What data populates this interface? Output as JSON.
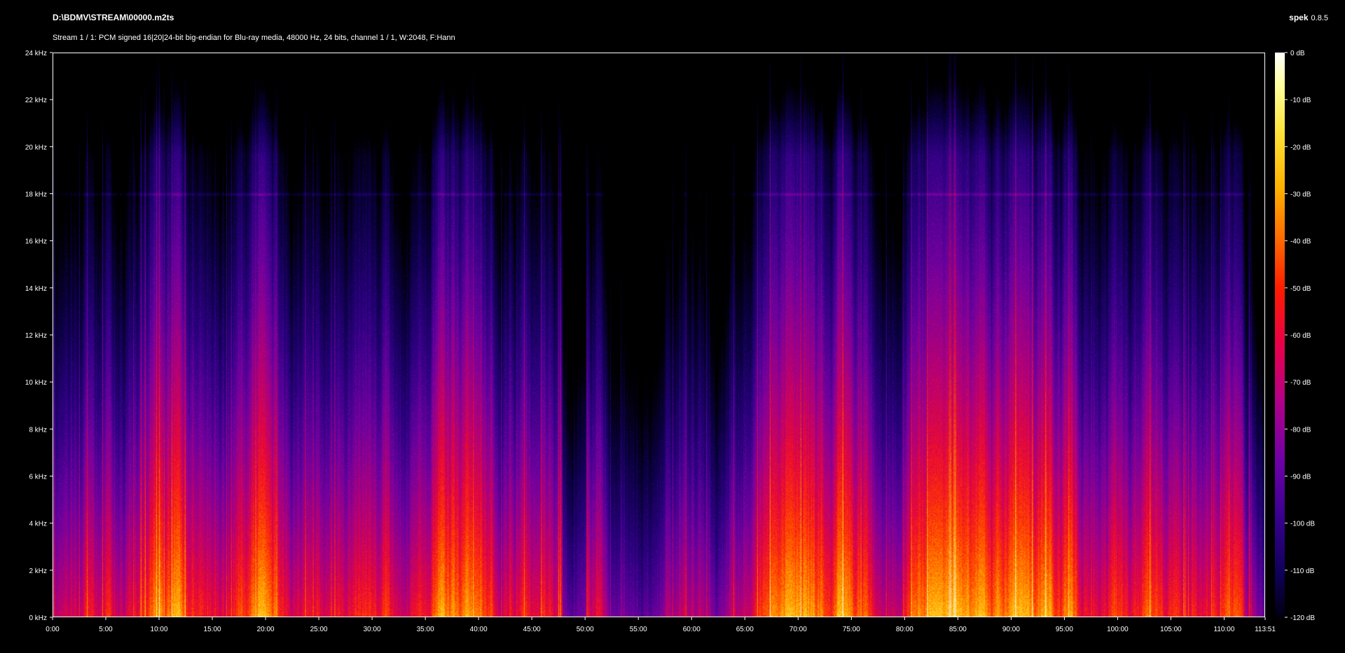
{
  "header": {
    "file_path": "D:\\BDMV\\STREAM\\00000.m2ts",
    "stream_info": "Stream 1 / 1: PCM signed 16|20|24-bit big-endian for Blu-ray media, 48000 Hz, 24 bits, channel 1 / 1, W:2048, F:Hann"
  },
  "app": {
    "name": "spek",
    "version": "0.8.5"
  },
  "freq_axis": {
    "ticks": [
      "24 kHz",
      "22 kHz",
      "20 kHz",
      "18 kHz",
      "16 kHz",
      "14 kHz",
      "12 kHz",
      "10 kHz",
      "8 kHz",
      "6 kHz",
      "4 kHz",
      "2 kHz",
      "0 kHz"
    ],
    "max_khz": 24
  },
  "time_axis": {
    "ticks": [
      "0:00",
      "5:00",
      "10:00",
      "15:00",
      "20:00",
      "25:00",
      "30:00",
      "35:00",
      "40:00",
      "45:00",
      "50:00",
      "55:00",
      "60:00",
      "65:00",
      "70:00",
      "75:00",
      "80:00",
      "85:00",
      "90:00",
      "95:00",
      "100:00",
      "105:00",
      "110:00",
      "113:51"
    ],
    "total_seconds": 6831
  },
  "db_scale": {
    "ticks": [
      "0 dB",
      "-10 dB",
      "-20 dB",
      "-30 dB",
      "-40 dB",
      "-50 dB",
      "-60 dB",
      "-70 dB",
      "-80 dB",
      "-90 dB",
      "-100 dB",
      "-110 dB",
      "-120 dB"
    ]
  },
  "colors": {
    "background": "#000000",
    "text": "#ffffff",
    "border": "#ffffff"
  }
}
